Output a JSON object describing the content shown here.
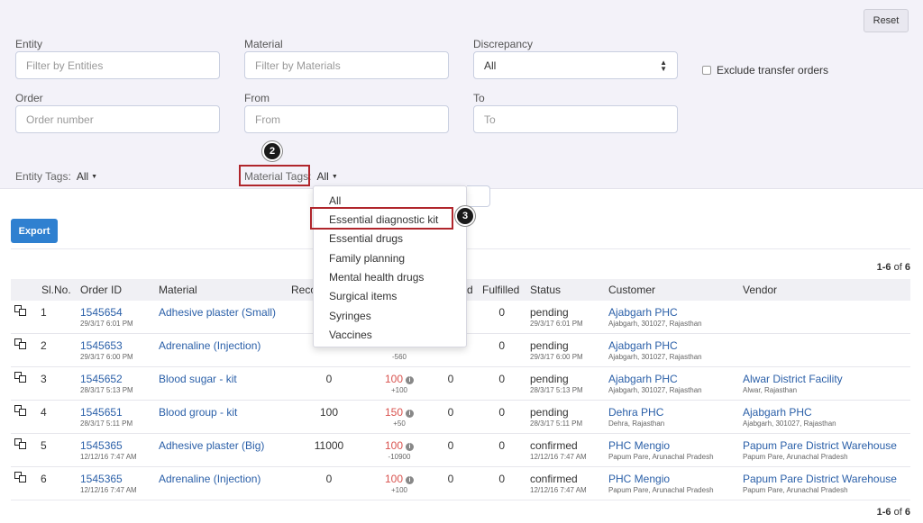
{
  "filters": {
    "reset_label": "Reset",
    "entity": {
      "label": "Entity",
      "placeholder": "Filter by Entities"
    },
    "material": {
      "label": "Material",
      "placeholder": "Filter by Materials"
    },
    "discrepancy": {
      "label": "Discrepancy",
      "value": "All"
    },
    "exclude_label": "Exclude transfer orders",
    "order": {
      "label": "Order",
      "placeholder": "Order number"
    },
    "from": {
      "label": "From",
      "placeholder": "From"
    },
    "to": {
      "label": "To",
      "placeholder": "To"
    },
    "entity_tags": {
      "label": "Entity Tags:",
      "value": "All"
    },
    "material_tags": {
      "label": "Material Tags:",
      "value": "All"
    }
  },
  "callouts": {
    "step2": "2",
    "step3": "3"
  },
  "dropdown": {
    "items": [
      "All",
      "Essential diagnostic kit",
      "Essential drugs",
      "Family planning",
      "Mental health drugs",
      "Surgical items",
      "Syringes",
      "Vaccines"
    ]
  },
  "toolbar": {
    "export_label": "Export"
  },
  "pager": {
    "range": "1-6",
    "of": "of",
    "total": "6"
  },
  "table": {
    "headers": {
      "slno": "Sl.No.",
      "order_id": "Order ID",
      "material": "Material",
      "recommended": "Reco",
      "fulfilled_prefix": "d",
      "fulfilled": "Fulfilled",
      "status": "Status",
      "customer": "Customer",
      "vendor": "Vendor"
    },
    "rows": [
      {
        "sl": "1",
        "order_id": "1545654",
        "order_date": "29/3/17 6:01 PM",
        "material": "Adhesive plaster (Small)",
        "recommended": "",
        "ordered": "",
        "ordered_delta": "",
        "shipped": "",
        "fulfilled": "0",
        "status": "pending",
        "status_date": "29/3/17 6:01 PM",
        "customer": "Ajabgarh PHC",
        "customer_addr": "Ajabgarh, 301027, Rajasthan",
        "vendor": "",
        "vendor_addr": ""
      },
      {
        "sl": "2",
        "order_id": "1545653",
        "order_date": "29/3/17 6:00 PM",
        "material": "Adrenaline (Injection)",
        "recommended": "",
        "ordered": "",
        "ordered_delta": "-560",
        "shipped": "",
        "fulfilled": "0",
        "status": "pending",
        "status_date": "29/3/17 6:00 PM",
        "customer": "Ajabgarh PHC",
        "customer_addr": "Ajabgarh, 301027, Rajasthan",
        "vendor": "",
        "vendor_addr": ""
      },
      {
        "sl": "3",
        "order_id": "1545652",
        "order_date": "28/3/17 5:13 PM",
        "material": "Blood sugar - kit",
        "recommended": "0",
        "ordered": "100",
        "ordered_delta": "+100",
        "shipped": "0",
        "fulfilled": "0",
        "status": "pending",
        "status_date": "28/3/17 5:13 PM",
        "customer": "Ajabgarh PHC",
        "customer_addr": "Ajabgarh, 301027, Rajasthan",
        "vendor": "Alwar District Facility",
        "vendor_addr": "Alwar, Rajasthan"
      },
      {
        "sl": "4",
        "order_id": "1545651",
        "order_date": "28/3/17 5:11 PM",
        "material": "Blood group - kit",
        "recommended": "100",
        "ordered": "150",
        "ordered_delta": "+50",
        "shipped": "0",
        "fulfilled": "0",
        "status": "pending",
        "status_date": "28/3/17 5:11 PM",
        "customer": "Dehra PHC",
        "customer_addr": "Dehra, Rajasthan",
        "vendor": "Ajabgarh PHC",
        "vendor_addr": "Ajabgarh, 301027, Rajasthan"
      },
      {
        "sl": "5",
        "order_id": "1545365",
        "order_date": "12/12/16 7:47 AM",
        "material": "Adhesive plaster (Big)",
        "recommended": "11000",
        "ordered": "100",
        "ordered_delta": "-10900",
        "shipped": "0",
        "fulfilled": "0",
        "status": "confirmed",
        "status_date": "12/12/16 7:47 AM",
        "customer": "PHC Mengio",
        "customer_addr": "Papum Pare, Arunachal Pradesh",
        "vendor": "Papum Pare District Warehouse",
        "vendor_addr": "Papum Pare, Arunachal Pradesh"
      },
      {
        "sl": "6",
        "order_id": "1545365",
        "order_date": "12/12/16 7:47 AM",
        "material": "Adrenaline (Injection)",
        "recommended": "0",
        "ordered": "100",
        "ordered_delta": "+100",
        "shipped": "0",
        "fulfilled": "0",
        "status": "confirmed",
        "status_date": "12/12/16 7:47 AM",
        "customer": "PHC Mengio",
        "customer_addr": "Papum Pare, Arunachal Pradesh",
        "vendor": "Papum Pare District Warehouse",
        "vendor_addr": "Papum Pare, Arunachal Pradesh"
      }
    ]
  },
  "colors": {
    "accent": "#2f80d0",
    "link": "#2a5fa8",
    "callout": "#b0262c",
    "discrepancy": "#d9534f"
  },
  "icons": {
    "row_action": "copy-icon",
    "info": "info-icon",
    "caret": "caret-down-icon"
  }
}
